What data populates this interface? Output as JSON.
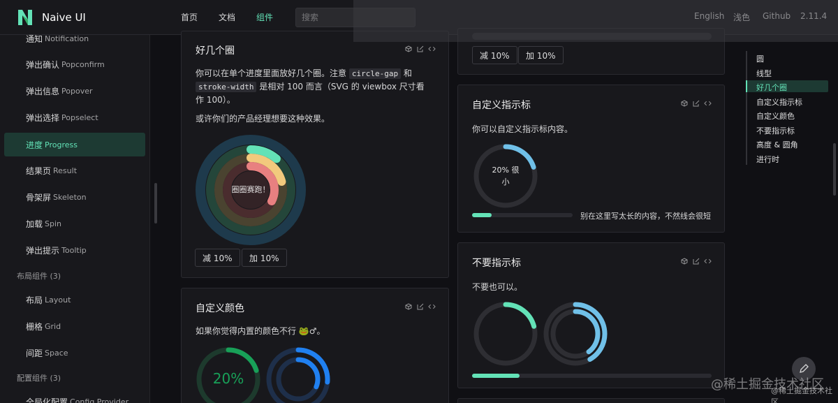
{
  "header": {
    "logo_text": "Naive UI",
    "nav": [
      "首页",
      "文档",
      "组件"
    ],
    "search_placeholder": "搜索",
    "right": [
      "English",
      "浅色",
      "Github",
      "2.11.4"
    ]
  },
  "sidebar": {
    "items": [
      {
        "cn": "通知",
        "en": "Notification"
      },
      {
        "cn": "弹出确认",
        "en": "Popconfirm"
      },
      {
        "cn": "弹出信息",
        "en": "Popover"
      },
      {
        "cn": "弹出选择",
        "en": "Popselect"
      },
      {
        "cn": "进度",
        "en": "Progress"
      },
      {
        "cn": "结果页",
        "en": "Result"
      },
      {
        "cn": "骨架屏",
        "en": "Skeleton"
      },
      {
        "cn": "加载",
        "en": "Spin"
      },
      {
        "cn": "弹出提示",
        "en": "Tooltip"
      }
    ],
    "group_layout": "布局组件 (3)",
    "layout_items": [
      {
        "cn": "布局",
        "en": "Layout"
      },
      {
        "cn": "栅格",
        "en": "Grid"
      },
      {
        "cn": "间距",
        "en": "Space"
      }
    ],
    "group_config": "配置组件 (3)",
    "config_items": [
      {
        "cn": "全局化配置",
        "en": "Config Provider"
      }
    ]
  },
  "cards": {
    "multi": {
      "title": "好几个圈",
      "p1_a": "你可以在单个进度里面放好几个圈。注意",
      "p1_code1": "circle-gap",
      "p1_b": "和",
      "p1_code2": "stroke-width",
      "p1_c": "是相对 100 而言（SVG 的 viewbox 尺寸看作 100）。",
      "p2": "或许你们的产品经理想要这种效果。",
      "center_text": "圈圈赛跑！",
      "btn_minus": "减 10%",
      "btn_plus": "加 10%"
    },
    "custom_color": {
      "title": "自定义颜色",
      "desc": "如果你觉得内置的颜色不行 🐸♂。",
      "value_text": "20%"
    },
    "top_right": {
      "btn_minus": "减 10%",
      "btn_plus": "加 10%"
    },
    "indicator": {
      "title": "自定义指示标",
      "desc": "你可以自定义指示标内容。",
      "circle_text_1": "20% 很",
      "circle_text_2": "小",
      "line_text": "别在这里写太长的内容，不然线会很短"
    },
    "no_indicator": {
      "title": "不要指示标",
      "desc": "不要也可以。"
    }
  },
  "anchors": [
    "圆",
    "线型",
    "好几个圈",
    "自定义指示标",
    "自定义颜色",
    "不要指示标",
    "高度 & 圆角",
    "进行时"
  ],
  "watermark": "@稀土掘金技术社区",
  "watermark_small": "@稀土掘金技术社区",
  "colors": {
    "accent": "#63e2b7",
    "info": "#70c0e8",
    "warning": "#f2c97d",
    "error": "#e88080",
    "blue": "#2080f0",
    "green": "#18a058"
  }
}
